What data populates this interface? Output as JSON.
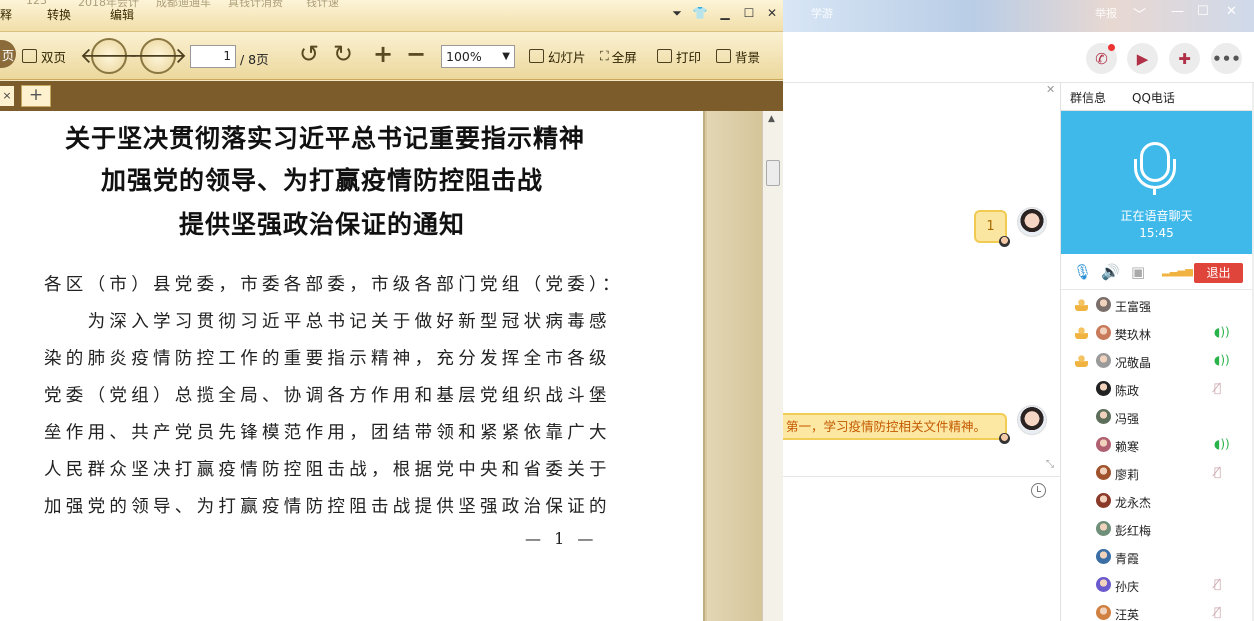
{
  "reader": {
    "menu": [
      "释",
      "转换",
      "编辑"
    ],
    "ghost_titles": [
      "123",
      "2018年会计",
      "成都迪通车",
      "真钱计消费",
      "钱计速"
    ],
    "toolbar": {
      "single_label": "页",
      "double_label": "双页",
      "page_current": "1",
      "page_total": "/ 8页",
      "zoom": "100%",
      "slideshow": "幻灯片",
      "fullscreen": "全屏",
      "print": "打印",
      "background": "背景"
    },
    "tabs": {
      "close": "×",
      "add": "+"
    },
    "document": {
      "title_lines": [
        "关于坚决贯彻落实习近平总书记重要指示精神",
        "加强党的领导、为打赢疫情防控阻击战",
        "提供坚强政治保证的通知"
      ],
      "paragraph_lines": [
        "各区（市）县党委，市委各部委，市级各部门党组（党委）：",
        "　　为深入学习贯彻习近平总书记关于做好新型冠状病毒感",
        "染的肺炎疫情防控工作的重要指示精神，充分发挥全市各级",
        "党委（党组）总揽全局、协调各方作用和基层党组织战斗堡",
        "垒作用、共产党员先锋模范作用，团结带领和紧紧依靠广大",
        "人民群众坚决打赢疫情防控阻击战，根据党中央和省委关于",
        "加强党的领导、为打赢疫情防控阻击战提供坚强政治保证的"
      ],
      "page_number": "— 1 —"
    }
  },
  "chat": {
    "banner": {
      "ghost": "学游",
      "report": "举报"
    },
    "messages": {
      "badge_count": "1",
      "message_text": "第一，学习疫情防控相关文件精神。"
    },
    "side": {
      "tab_group_info": "群信息",
      "tab_qq_call": "QQ电话",
      "voice_status": "正在语音聊天",
      "voice_time": "15:45",
      "exit_label": "退出",
      "members": [
        {
          "name": "王富强",
          "admin": true,
          "status": "none",
          "avatar_color": "#7a6f6a"
        },
        {
          "name": "樊玖林",
          "admin": true,
          "status": "speaking",
          "avatar_color": "#c87a5a"
        },
        {
          "name": "况敬晶",
          "admin": true,
          "status": "speaking",
          "avatar_color": "#9a9a9a"
        },
        {
          "name": "陈政",
          "admin": false,
          "status": "muted",
          "avatar_color": "#222222"
        },
        {
          "name": "冯强",
          "admin": false,
          "status": "none",
          "avatar_color": "#5d6e5a"
        },
        {
          "name": "赖寒",
          "admin": false,
          "status": "speaking",
          "avatar_color": "#b06070"
        },
        {
          "name": "廖莉",
          "admin": false,
          "status": "muted",
          "avatar_color": "#a0522d"
        },
        {
          "name": "龙永杰",
          "admin": false,
          "status": "none",
          "avatar_color": "#8b3a2a"
        },
        {
          "name": "彭红梅",
          "admin": false,
          "status": "none",
          "avatar_color": "#6f8f7a"
        },
        {
          "name": "青霞",
          "admin": false,
          "status": "none",
          "avatar_color": "#3a6ea5"
        },
        {
          "name": "孙庆",
          "admin": false,
          "status": "muted",
          "avatar_color": "#6a5acd"
        },
        {
          "name": "汪英",
          "admin": false,
          "status": "muted",
          "avatar_color": "#d08040"
        }
      ]
    }
  }
}
